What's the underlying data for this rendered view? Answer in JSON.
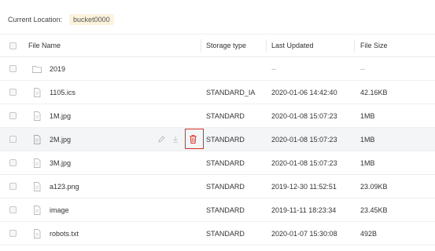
{
  "location": {
    "label": "Current Location:",
    "bucket": "bucket0000"
  },
  "table": {
    "columns": {
      "name": "File Name",
      "type": "Storage type",
      "updated": "Last Updated",
      "size": "File Size"
    },
    "rows": [
      {
        "name": "2019",
        "type": "",
        "updated": "--",
        "size": "--",
        "icon": "folder-icon"
      },
      {
        "name": "1105.ics",
        "type": "STANDARD_IA",
        "updated": "2020-01-06 14:42:40",
        "size": "42.16KB",
        "icon": "file-icon"
      },
      {
        "name": "1M.jpg",
        "type": "STANDARD",
        "updated": "2020-01-08 15:07:23",
        "size": "1MB",
        "icon": "file-icon"
      },
      {
        "name": "2M.jpg",
        "type": "STANDARD",
        "updated": "2020-01-08 15:07:23",
        "size": "1MB",
        "icon": "file-icon"
      },
      {
        "name": "3M.jpg",
        "type": "STANDARD",
        "updated": "2020-01-08 15:07:23",
        "size": "1MB",
        "icon": "file-icon"
      },
      {
        "name": "a123.png",
        "type": "STANDARD",
        "updated": "2019-12-30 11:52:51",
        "size": "23.09KB",
        "icon": "file-icon"
      },
      {
        "name": "image",
        "type": "STANDARD",
        "updated": "2019-11-11 18:23:34",
        "size": "23.45KB",
        "icon": "file-icon"
      },
      {
        "name": "robots.txt",
        "type": "STANDARD",
        "updated": "2020-01-07 15:30:08",
        "size": "492B",
        "icon": "file-icon"
      }
    ]
  },
  "colors": {
    "delete_highlight": "#d93025",
    "badge_bg": "#fbf3dc",
    "hover_row": "#f4f5f7"
  }
}
